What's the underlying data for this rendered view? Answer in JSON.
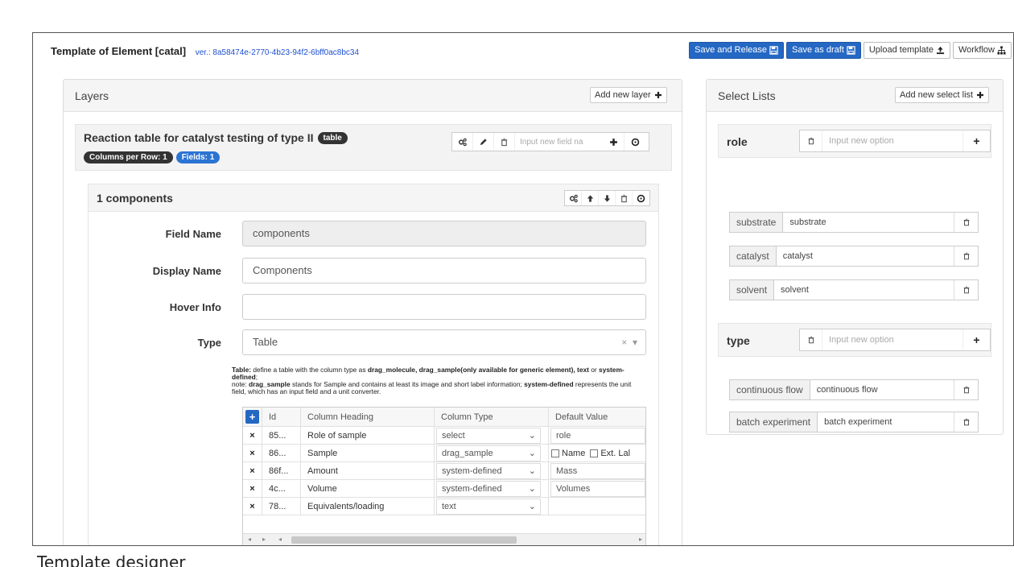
{
  "header": {
    "title": "Template of Element [catal]",
    "version": "ver.: 8a58474e-2770-4b23-94f2-6bff0ac8bc34",
    "buttons": {
      "save_release": "Save and Release",
      "save_draft": "Save as draft",
      "upload": "Upload template",
      "workflow": "Workflow"
    }
  },
  "layers": {
    "title": "Layers",
    "add_button": "Add new layer",
    "layer": {
      "title": "Reaction table for catalyst testing of type II",
      "badge": "table",
      "pills": [
        "Columns per Row: 1",
        "Fields: 1"
      ],
      "field_input_placeholder": "Input new field na"
    },
    "component": {
      "title": "1 components",
      "fields": {
        "field_name_label": "Field Name",
        "field_name_value": "components",
        "display_name_label": "Display Name",
        "display_name_value": "Components",
        "hover_info_label": "Hover Info",
        "hover_info_value": "",
        "type_label": "Type",
        "type_value": "Table",
        "type_clear": "×",
        "type_arrow": "▾"
      },
      "help": {
        "p1": "Table:",
        "p2": " define a table with the column type as ",
        "p3": "drag_molecule, drag_sample(only available for generic element), text",
        "p4": " or ",
        "p5": "system-defined",
        "p6": ";",
        "p7": "note: ",
        "p8": "drag_sample",
        "p9": " stands for Sample and contains at least its image and short label information; ",
        "p10": "system-defined",
        "p11": " represents the unit field, which has an input field and a unit converter."
      },
      "table": {
        "add": "+",
        "headers": [
          "Id",
          "Column Heading",
          "Column Type",
          "Default Value"
        ],
        "rows": [
          {
            "remove": "×",
            "id": "85...",
            "heading": "Role of sample",
            "type": "select",
            "default": "role"
          },
          {
            "remove": "×",
            "id": "86...",
            "heading": "Sample",
            "type": "drag_sample",
            "default_checks": [
              "Name",
              "Ext. Lal"
            ]
          },
          {
            "remove": "×",
            "id": "86f...",
            "heading": "Amount",
            "type": "system-defined",
            "default": "Mass"
          },
          {
            "remove": "×",
            "id": "4c...",
            "heading": "Volume",
            "type": "system-defined",
            "default": "Volumes"
          },
          {
            "remove": "×",
            "id": "78...",
            "heading": "Equivalents/loading",
            "type": "text",
            "default": ""
          }
        ],
        "scroll_left": "◂",
        "scroll_left2": "▸",
        "scroll_left3": "◂",
        "scroll_right": "▸"
      }
    }
  },
  "select_lists": {
    "title": "Select Lists",
    "add_button": "Add new select list",
    "option_placeholder": "Input new option",
    "plus": "+",
    "lists": [
      {
        "name": "role",
        "options": [
          {
            "label": "substrate",
            "value": "substrate"
          },
          {
            "label": "catalyst",
            "value": "catalyst"
          },
          {
            "label": "solvent",
            "value": "solvent"
          }
        ]
      },
      {
        "name": "type",
        "options": [
          {
            "label": "continuous flow",
            "value": "continuous flow"
          },
          {
            "label": "batch experiment",
            "value": "batch experiment"
          }
        ]
      }
    ]
  },
  "caption": "Template designer",
  "colors": {
    "primary": "#2568c4",
    "pill_dark": "#333333",
    "pill_blue": "#2b74d3"
  }
}
